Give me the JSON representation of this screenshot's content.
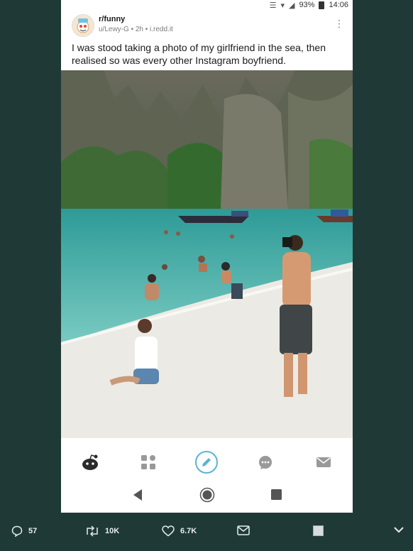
{
  "status_bar": {
    "battery": "93%",
    "time": "14:06"
  },
  "post": {
    "subreddit": "r/funny",
    "meta": "u/Lewy-G • 2h • i.redd.it",
    "title": "I was stood taking a photo of my girlfriend in the sea, then realised so was every other Instagram boyfriend."
  },
  "bottom_nav": [
    "home-icon",
    "communities-icon",
    "create-post-icon",
    "chat-icon",
    "inbox-icon"
  ],
  "system_nav": [
    "back-icon",
    "home-circle-icon",
    "recents-icon"
  ],
  "tweet_actions": {
    "replies": "57",
    "retweets": "10K",
    "likes": "6.7K"
  },
  "colors": {
    "background": "#1f3a36",
    "accent": "#5ab4d4",
    "sea": "#4fb3ad",
    "sand": "#eceae4"
  }
}
